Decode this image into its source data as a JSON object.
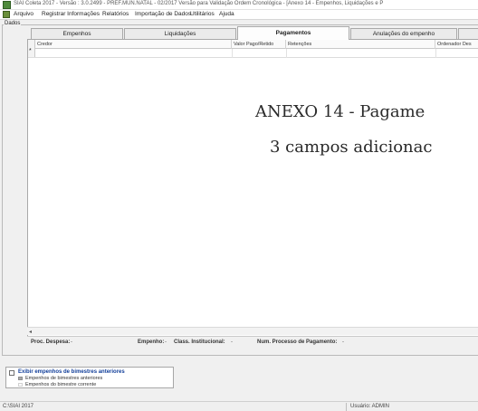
{
  "window": {
    "title": "SIAI Coleta 2017 - Versão : 3.0.2499 - PREF.MUN.NATAL - 02/2017 Versão para Validação Ordem Cronológica - [Anexo 14 - Empenhos, Liquidações e P"
  },
  "menu": {
    "arquivo": "Arquivo",
    "registrar": "Registrar Informações",
    "relatorios": "Relatórios",
    "importacao": "Importação de Dados",
    "utilitarios": "Utilitários",
    "ajuda": "Ajuda"
  },
  "frame_label": "Dados",
  "tabs": [
    {
      "label": "Empenhos"
    },
    {
      "label": "Liquidações"
    },
    {
      "label": "Pagamentos"
    },
    {
      "label": "Anulações do empenho"
    },
    {
      "label": ""
    }
  ],
  "grid": {
    "columns": [
      {
        "label": "Credor"
      },
      {
        "label": "Valor Pago/Retido"
      },
      {
        "label": "Retenções"
      },
      {
        "label": "Ordenador Des"
      }
    ],
    "new_row_marker": "*"
  },
  "overlay": {
    "line1": "ANEXO 14 - Pagame",
    "line2": "3 campos adicionac"
  },
  "scroll_left": "◂",
  "details": {
    "proc_despesa_label": "Proc. Despesa:",
    "proc_despesa_value": "-",
    "empenho_label": "Empenho:",
    "empenho_value": "-",
    "class_label": "Class. Institucional:",
    "class_value": "-",
    "num_processo_label": "Num. Processo de Pagamento:",
    "num_processo_value": "-"
  },
  "bimestre": {
    "label": "Exibir empenhos de bimestres anteriores",
    "checked": false,
    "legend_prev": "Empenhos de bimestres anteriores",
    "legend_curr": "Empenhos do bimestre corrente"
  },
  "status": {
    "left": "C:\\SIAI 2017",
    "user": "Usuário: ADMIN"
  },
  "colors": {
    "brand_green": "#4f8a3c",
    "link_blue": "#123f9a"
  },
  "icons": {
    "app": "app-icon",
    "menu": "menu-icon"
  }
}
